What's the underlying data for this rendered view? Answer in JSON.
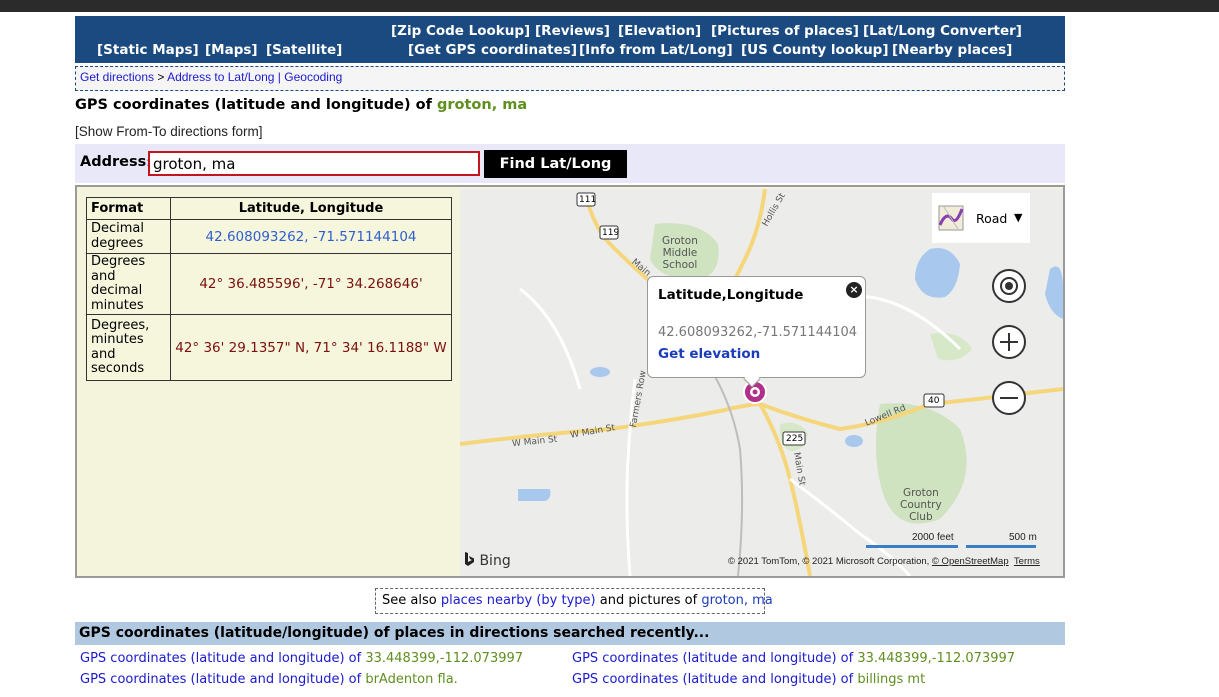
{
  "nav": {
    "row1": [
      "[Zip Code Lookup]",
      "[Reviews]",
      "[Elevation]",
      "[Pictures of places]",
      "[Lat/Long Converter]"
    ],
    "row2_left": [
      "[Static Maps]",
      "[Maps]",
      "[Satellite]"
    ],
    "row2_right": [
      "[Get GPS coordinates]",
      "[Info from Lat/Long]",
      "[US County lookup]",
      "[Nearby places]"
    ]
  },
  "breadcrumb": {
    "link1": "Get directions",
    "sep": " > ",
    "link2": "Address to Lat/Long | Geocoding"
  },
  "title": {
    "prefix": "GPS coordinates (latitude and longitude) of ",
    "place": "groton, ma"
  },
  "show_form": "[Show From-To directions form]",
  "address": {
    "label": "Address",
    "value": "groton, ma",
    "button": "Find Lat/Long"
  },
  "coords_table": {
    "headers": [
      "Format",
      "Latitude, Longitude"
    ],
    "rows": [
      {
        "format": "Decimal degrees",
        "value": "42.608093262, -71.571144104"
      },
      {
        "format": "Degrees and decimal minutes",
        "value": "42° 36.485596', -71° 34.268646'"
      },
      {
        "format": "Degrees, minutes and seconds",
        "value": "42° 36' 29.1357\" N, 71° 34' 16.1188\" W"
      }
    ]
  },
  "map": {
    "popup_title": "Latitude,Longitude",
    "popup_value": "42.608093262,-71.571144104",
    "popup_link": "Get elevation",
    "close": "×",
    "style_label": "Road",
    "labels": {
      "school": [
        "Groton",
        "Middle",
        "School"
      ],
      "club": [
        "Groton",
        "Country",
        "Club"
      ],
      "hollis": "Hollis St",
      "main_n": "Main",
      "farmers": "Farmers Row",
      "wmain1": "W Main St",
      "wmain2": "W Main St",
      "lowell": "Lowell Rd",
      "mainst": "Main St",
      "r111": "111",
      "r119": "119",
      "r40": "40",
      "r225": "225"
    },
    "bing": "Bing",
    "copyright_prefix": "© 2021 TomTom, © 2021 Microsoft Corporation, ",
    "osm": "© OpenStreetMap",
    "terms": "Terms",
    "scale_ft": "2000 feet",
    "scale_m": "500 m"
  },
  "see_also": {
    "prefix": "See also ",
    "link": "places nearby (by type)",
    "mid": " and pictures of ",
    "place": "groton, ma"
  },
  "recent": {
    "heading": "GPS coordinates (latitude/longitude) of places in directions searched recently...",
    "prefix": "GPS coordinates (latitude and longitude) of ",
    "items": [
      "33.448399,-112.073997",
      "33.448399,-112.073997",
      "brAdenton fla.",
      "billings mt"
    ]
  },
  "colors": {
    "nav_bg": "#1a4a80",
    "place_green": "#5f8f1f",
    "link_blue": "#1a1ad0",
    "panel_bg": "#f4f4dc",
    "pin": "#b0308a"
  }
}
